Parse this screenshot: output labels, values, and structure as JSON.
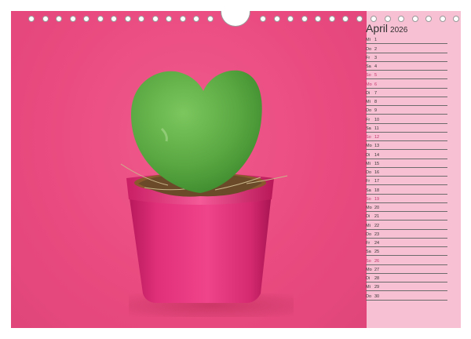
{
  "calendar": {
    "month": "April",
    "year": "2026",
    "days": [
      {
        "wd": "Mi",
        "d": "1"
      },
      {
        "wd": "Do",
        "d": "2"
      },
      {
        "wd": "Fr",
        "d": "3"
      },
      {
        "wd": "Sa",
        "d": "4"
      },
      {
        "wd": "So",
        "d": "5",
        "sunday": true
      },
      {
        "wd": "Mo",
        "d": "6",
        "sunday": true
      },
      {
        "wd": "Di",
        "d": "7"
      },
      {
        "wd": "Mi",
        "d": "8"
      },
      {
        "wd": "Do",
        "d": "9"
      },
      {
        "wd": "Fr",
        "d": "10"
      },
      {
        "wd": "Sa",
        "d": "11"
      },
      {
        "wd": "So",
        "d": "12",
        "sunday": true
      },
      {
        "wd": "Mo",
        "d": "13"
      },
      {
        "wd": "Di",
        "d": "14"
      },
      {
        "wd": "Mi",
        "d": "15"
      },
      {
        "wd": "Do",
        "d": "16"
      },
      {
        "wd": "Fr",
        "d": "17"
      },
      {
        "wd": "Sa",
        "d": "18"
      },
      {
        "wd": "So",
        "d": "19",
        "sunday": true
      },
      {
        "wd": "Mo",
        "d": "20"
      },
      {
        "wd": "Di",
        "d": "21"
      },
      {
        "wd": "Mi",
        "d": "22"
      },
      {
        "wd": "Do",
        "d": "23"
      },
      {
        "wd": "Fr",
        "d": "24"
      },
      {
        "wd": "Sa",
        "d": "25"
      },
      {
        "wd": "So",
        "d": "26",
        "sunday": true
      },
      {
        "wd": "Mo",
        "d": "27"
      },
      {
        "wd": "Di",
        "d": "28"
      },
      {
        "wd": "Mi",
        "d": "29"
      },
      {
        "wd": "Do",
        "d": "30"
      }
    ]
  },
  "colors": {
    "background": "#e84a7e",
    "sidebar": "#f7c0d3",
    "sunday": "#c2346a",
    "plant": "#5fae4a",
    "pot": "#e0307a"
  },
  "icons": [
    "binding-hole-icon",
    "hanger-notch-icon"
  ]
}
